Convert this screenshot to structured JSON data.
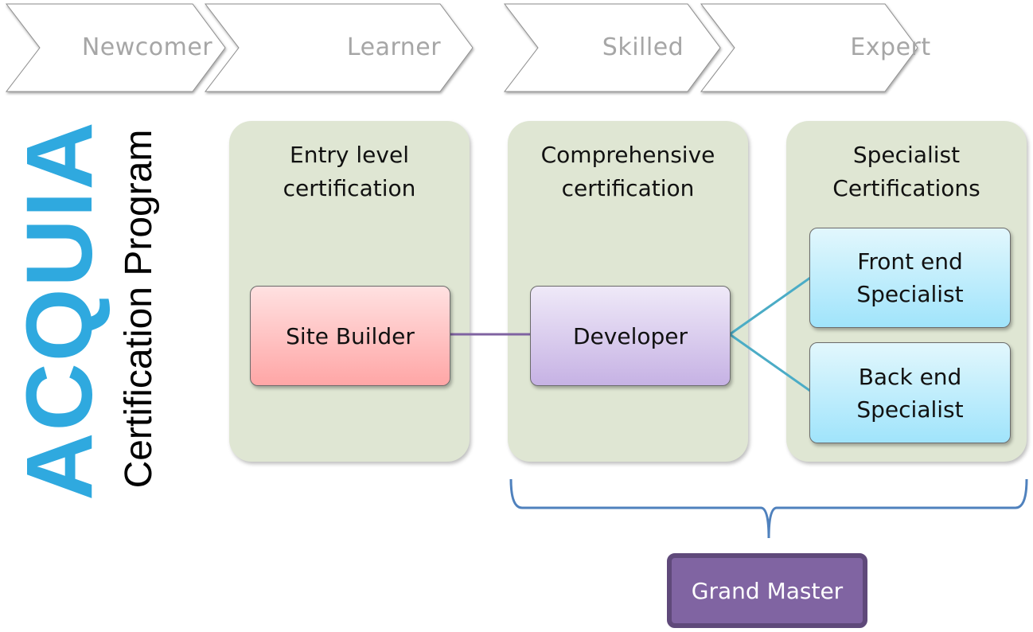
{
  "stages": [
    {
      "label": "Newcomer"
    },
    {
      "label": "Learner"
    },
    {
      "label": "Skilled"
    },
    {
      "label": "Expert"
    }
  ],
  "logo": {
    "brand": "ACQUIA",
    "subtitle": "Certification Program",
    "color": "#2fa9df"
  },
  "panels": [
    {
      "title": "Entry level\ncertification",
      "title_line1": "Entry level",
      "title_line2": "certification"
    },
    {
      "title": "Comprehensive\ncertification",
      "title_line1": "Comprehensive",
      "title_line2": "certification"
    },
    {
      "title": "Specialist\nCertifications",
      "title_line1": "Specialist",
      "title_line2": "Certifications"
    }
  ],
  "nodes": {
    "site_builder": {
      "label": "Site Builder",
      "color": "#ffb3b3"
    },
    "developer": {
      "label": "Developer",
      "color": "#d3c2ea"
    },
    "front_end": {
      "label_line1": "Front end",
      "label_line2": "Specialist",
      "color": "#b8ecfb"
    },
    "back_end": {
      "label_line1": "Back end",
      "label_line2": "Specialist",
      "color": "#b8ecfb"
    }
  },
  "grand_master": {
    "label": "Grand Master",
    "color": "#8064a2"
  },
  "colors": {
    "panel_bg": "#dfe6d3",
    "connector_purple": "#7f63a1",
    "connector_teal": "#4bacc6",
    "brace": "#4f81bd",
    "stage_text": "#a6a6a6"
  }
}
